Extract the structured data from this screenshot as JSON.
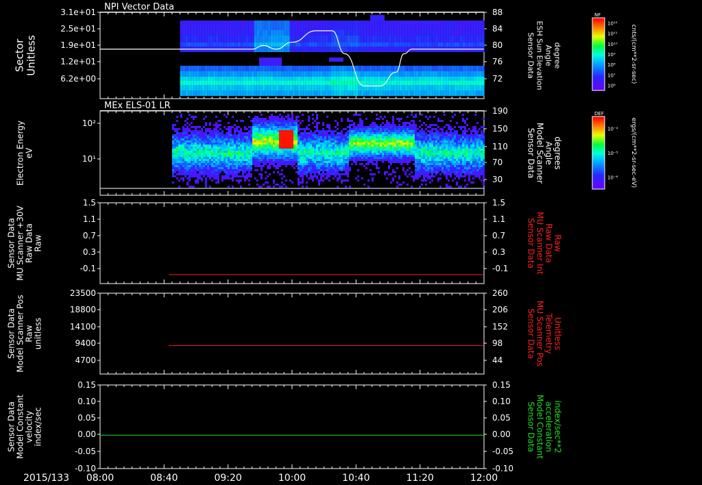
{
  "footer": {
    "date": "2015/133",
    "x_ticks": [
      "08:00",
      "08:40",
      "09:20",
      "10:00",
      "10:40",
      "11:20",
      "12:00"
    ]
  },
  "panels": [
    {
      "title": "NPI Vector Data",
      "left_label": [
        "Sector",
        "Unitless"
      ],
      "left_ticks": [
        "3.1e+01",
        "2.5e+01",
        "1.9e+01",
        "1.2e+01",
        "6.2e+00"
      ],
      "right_ticks": [
        "88",
        "84",
        "80",
        "76",
        "72"
      ],
      "right_label": [
        "Sensor Data",
        "ESH Sun Elevation",
        "Angle",
        "degree"
      ],
      "colorbar": {
        "tag": "NF",
        "unit": "cnts/(cm**2-sr-sec)",
        "ticks": [
          "10¹²",
          "10¹¹",
          "10¹⁰",
          "10⁹",
          "10⁸",
          "10⁷",
          "10⁶"
        ]
      }
    },
    {
      "title": "MEx ELS-01 LR",
      "left_label": [
        "Electron Energy",
        "eV"
      ],
      "left_ticks": [
        "10²",
        "10¹"
      ],
      "right_ticks": [
        "190",
        "150",
        "110",
        "70",
        "30"
      ],
      "right_label": [
        "Sensor Data",
        "Model Scanner",
        "Angle",
        "degrees"
      ],
      "colorbar": {
        "tag": "DEF",
        "unit": "ergs/(cm**2-sr-sec-eV)",
        "ticks": [
          "10⁻⁴",
          "10⁻⁵",
          "10⁻⁶"
        ]
      }
    },
    {
      "left_label": [
        "Sensor Data",
        "MU Scanner +30V",
        "Raw Data",
        "Raw"
      ],
      "left_ticks": [
        "1.5",
        "1.1",
        "0.7",
        "0.3",
        "-0.1"
      ],
      "right_ticks": [
        "1.5",
        "1.1",
        "0.7",
        "0.3",
        "-0.1"
      ],
      "right_label": [
        "Sensor Data",
        "MU Scanner Int",
        "Raw Data",
        "Raw"
      ],
      "colors": {
        "line": "#ff2020",
        "right_label": "#ff2020"
      }
    },
    {
      "left_label": [
        "Sensor Data",
        "Model Scanner Pos",
        "Raw",
        "unitless"
      ],
      "left_ticks": [
        "23500",
        "18800",
        "14100",
        "9400",
        "4700"
      ],
      "right_ticks": [
        "260",
        "206",
        "152",
        "98",
        "44"
      ],
      "right_label": [
        "Sensor Data",
        "MU Scanner Pos",
        "Telemetry",
        "Unitless"
      ],
      "colors": {
        "line": "#ff2020",
        "right_label": "#ff2020"
      }
    },
    {
      "left_label": [
        "Sensor Data",
        "Model Constant",
        "velocity",
        "index/sec"
      ],
      "left_ticks": [
        "0.15",
        "0.10",
        "0.05",
        "0.00",
        "-0.05",
        "-0.10"
      ],
      "right_ticks": [
        "0.15",
        "0.10",
        "0.05",
        "0.00",
        "-0.05",
        "-0.10"
      ],
      "right_label": [
        "Sensor Data",
        "Model Constant",
        "acceleration",
        "index/sec**2"
      ],
      "colors": {
        "line": "#20e020",
        "right_label": "#20e020"
      }
    }
  ],
  "chart_data": [
    {
      "type": "heatmap",
      "title": "NPI Vector Data",
      "x_range": [
        "08:00",
        "12:00"
      ],
      "data_start": "08:50",
      "y_left": {
        "label": "Sector Unitless",
        "ticks": [
          31,
          25,
          19,
          12,
          6.2
        ]
      },
      "y_right": {
        "label": "Sensor Data ESH Sun Elevation Angle degree",
        "range": [
          70,
          88
        ]
      },
      "overlay_line": {
        "name": "ESH Sun Elevation Angle",
        "x": [
          "08:00",
          "09:35",
          "09:42",
          "09:50",
          "10:00",
          "10:15",
          "10:25",
          "10:33",
          "10:45",
          "10:55",
          "11:05",
          "11:10",
          "11:15",
          "12:00"
        ],
        "y": [
          80,
          80,
          80.8,
          80,
          81.5,
          84,
          84,
          79,
          72,
          72,
          75,
          79,
          80,
          80
        ]
      }
    },
    {
      "type": "heatmap",
      "title": "MEx ELS-01 LR",
      "x_range": [
        "08:00",
        "12:00"
      ],
      "data_start": "08:45",
      "y_left": {
        "label": "Electron Energy eV",
        "scale": "log"
      },
      "y_right": {
        "label": "Sensor Data Model Scanner Angle degrees",
        "range": [
          10,
          190
        ]
      },
      "overlay_line": {
        "name": "Model Scanner Angle",
        "x": [
          "08:00",
          "12:00"
        ],
        "y": [
          10,
          10
        ]
      }
    },
    {
      "type": "line",
      "x_range": [
        "08:00",
        "12:00"
      ],
      "ylim": [
        -0.3,
        1.5
      ],
      "series": [
        {
          "x": [
            "08:43",
            "12:00"
          ],
          "y": [
            -0.1,
            -0.1
          ]
        }
      ]
    },
    {
      "type": "line",
      "x_range": [
        "08:00",
        "12:00"
      ],
      "ylim": [
        0,
        23500
      ],
      "series": [
        {
          "x": [
            "08:43",
            "12:00"
          ],
          "y": [
            8300,
            8300
          ]
        }
      ]
    },
    {
      "type": "line",
      "x_range": [
        "08:00",
        "12:00"
      ],
      "ylim": [
        -0.1,
        0.15
      ],
      "series": [
        {
          "x": [
            "08:00",
            "12:00"
          ],
          "y": [
            0.0,
            0.0
          ]
        }
      ]
    }
  ]
}
